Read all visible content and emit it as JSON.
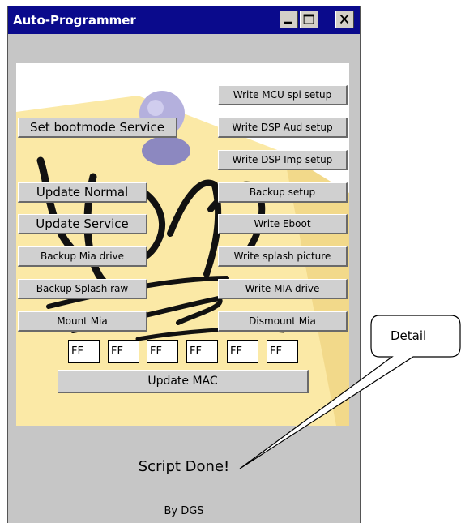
{
  "window": {
    "title": "Auto-Programmer"
  },
  "titlebar_icons": [
    "minimize-icon",
    "maximize-icon",
    "close-icon"
  ],
  "buttons": {
    "set_bootmode_service": "Set bootmode Service",
    "write_mcu_spi_setup": "Write MCU spi setup",
    "write_dsp_aud_setup": "Write DSP Aud setup",
    "write_dsp_imp_setup": "Write DSP Imp setup",
    "update_normal": "Update Normal",
    "backup_setup": "Backup setup",
    "update_service": "Update Service",
    "write_eboot": "Write Eboot",
    "backup_mia_drive": "Backup Mia drive",
    "write_splash_picture": "Write splash picture",
    "backup_splash_raw": "Backup Splash raw",
    "write_mia_drive": "Write MIA drive",
    "mount_mia": "Mount Mia",
    "dismount_mia": "Dismount Mia",
    "update_mac": "Update MAC"
  },
  "mac_fields": [
    "FF",
    "FF",
    "FF",
    "FF",
    "FF",
    "FF"
  ],
  "status": "Script Done!",
  "footer": "By DGS",
  "callout": {
    "label": "Detail"
  },
  "colors": {
    "titlebar": "#0a0a8c",
    "window_bg": "#c6c6c6",
    "note_yellow": "#fbe9a6",
    "pin_purple": "#b4b0dd"
  }
}
